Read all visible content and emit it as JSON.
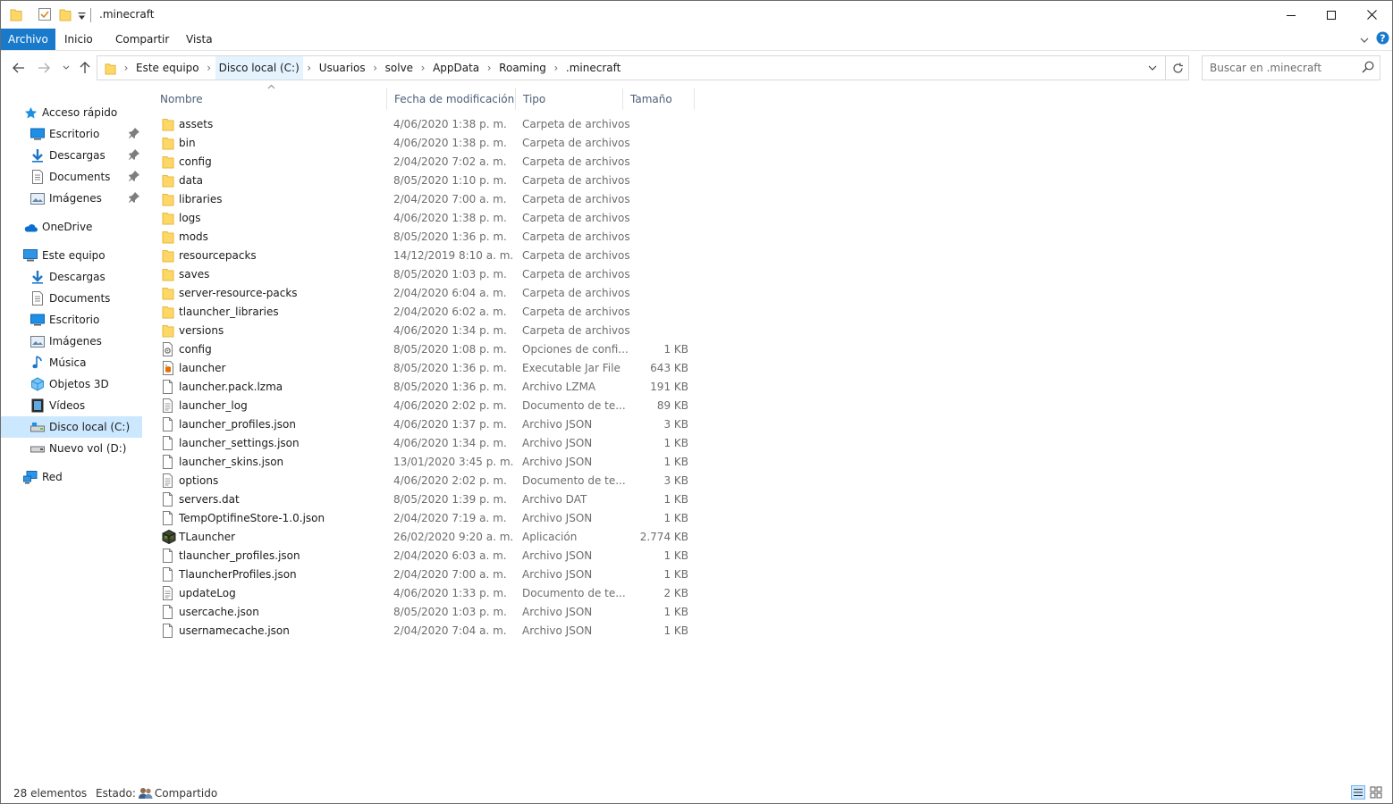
{
  "window": {
    "title": ".minecraft"
  },
  "ribbon": {
    "tabs": [
      "Archivo",
      "Inicio",
      "Compartir",
      "Vista"
    ]
  },
  "address": {
    "crumbs": [
      "Este equipo",
      "Disco local (C:)",
      "Usuarios",
      "solve",
      "AppData",
      "Roaming",
      ".minecraft"
    ],
    "search_placeholder": "Buscar en .minecraft"
  },
  "nav": {
    "items": [
      {
        "label": "Acceso rápido",
        "icon": "star-icon"
      },
      {
        "label": "Escritorio",
        "icon": "desktop-icon",
        "pinned": true
      },
      {
        "label": "Descargas",
        "icon": "download-icon",
        "pinned": true
      },
      {
        "label": "Documents",
        "icon": "document-icon",
        "pinned": true
      },
      {
        "label": "Imágenes",
        "icon": "image-icon",
        "pinned": true
      },
      {
        "label": "OneDrive",
        "icon": "cloud-icon"
      },
      {
        "label": "Este equipo",
        "icon": "computer-icon"
      },
      {
        "label": "Descargas",
        "icon": "download-icon"
      },
      {
        "label": "Documents",
        "icon": "document-icon"
      },
      {
        "label": "Escritorio",
        "icon": "desktop-icon"
      },
      {
        "label": "Imágenes",
        "icon": "image-icon"
      },
      {
        "label": "Música",
        "icon": "music-icon"
      },
      {
        "label": "Objetos 3D",
        "icon": "cube-icon"
      },
      {
        "label": "Vídeos",
        "icon": "video-icon"
      },
      {
        "label": "Disco local (C:)",
        "icon": "drive-icon",
        "selected": true
      },
      {
        "label": "Nuevo vol (D:)",
        "icon": "drive-icon"
      },
      {
        "label": "Red",
        "icon": "network-icon"
      }
    ]
  },
  "columns": {
    "name": "Nombre",
    "date": "Fecha de modificación",
    "type": "Tipo",
    "size": "Tamaño"
  },
  "files": [
    {
      "name": "assets",
      "date": "4/06/2020 1:38 p. m.",
      "type": "Carpeta de archivos",
      "size": "",
      "icon": "folder-icon"
    },
    {
      "name": "bin",
      "date": "4/06/2020 1:38 p. m.",
      "type": "Carpeta de archivos",
      "size": "",
      "icon": "folder-icon"
    },
    {
      "name": "config",
      "date": "2/04/2020 7:02 a. m.",
      "type": "Carpeta de archivos",
      "size": "",
      "icon": "folder-icon"
    },
    {
      "name": "data",
      "date": "8/05/2020 1:10 p. m.",
      "type": "Carpeta de archivos",
      "size": "",
      "icon": "folder-icon"
    },
    {
      "name": "libraries",
      "date": "2/04/2020 7:00 a. m.",
      "type": "Carpeta de archivos",
      "size": "",
      "icon": "folder-icon"
    },
    {
      "name": "logs",
      "date": "4/06/2020 1:38 p. m.",
      "type": "Carpeta de archivos",
      "size": "",
      "icon": "folder-icon"
    },
    {
      "name": "mods",
      "date": "8/05/2020 1:36 p. m.",
      "type": "Carpeta de archivos",
      "size": "",
      "icon": "folder-icon"
    },
    {
      "name": "resourcepacks",
      "date": "14/12/2019 8:10 a. m.",
      "type": "Carpeta de archivos",
      "size": "",
      "icon": "folder-icon"
    },
    {
      "name": "saves",
      "date": "8/05/2020 1:03 p. m.",
      "type": "Carpeta de archivos",
      "size": "",
      "icon": "folder-icon"
    },
    {
      "name": "server-resource-packs",
      "date": "2/04/2020 6:04 a. m.",
      "type": "Carpeta de archivos",
      "size": "",
      "icon": "folder-icon"
    },
    {
      "name": "tlauncher_libraries",
      "date": "2/04/2020 6:02 a. m.",
      "type": "Carpeta de archivos",
      "size": "",
      "icon": "folder-icon"
    },
    {
      "name": "versions",
      "date": "4/06/2020 1:34 p. m.",
      "type": "Carpeta de archivos",
      "size": "",
      "icon": "folder-icon"
    },
    {
      "name": "config",
      "date": "8/05/2020 1:08 p. m.",
      "type": "Opciones de confi...",
      "size": "1 KB",
      "icon": "settings-file-icon"
    },
    {
      "name": "launcher",
      "date": "8/05/2020 1:36 p. m.",
      "type": "Executable Jar File",
      "size": "643 KB",
      "icon": "jar-file-icon"
    },
    {
      "name": "launcher.pack.lzma",
      "date": "8/05/2020 1:36 p. m.",
      "type": "Archivo LZMA",
      "size": "191 KB",
      "icon": "file-icon"
    },
    {
      "name": "launcher_log",
      "date": "4/06/2020 2:02 p. m.",
      "type": "Documento de te...",
      "size": "89 KB",
      "icon": "text-file-icon"
    },
    {
      "name": "launcher_profiles.json",
      "date": "4/06/2020 1:37 p. m.",
      "type": "Archivo JSON",
      "size": "3 KB",
      "icon": "file-icon"
    },
    {
      "name": "launcher_settings.json",
      "date": "4/06/2020 1:34 p. m.",
      "type": "Archivo JSON",
      "size": "1 KB",
      "icon": "file-icon"
    },
    {
      "name": "launcher_skins.json",
      "date": "13/01/2020 3:45 p. m.",
      "type": "Archivo JSON",
      "size": "1 KB",
      "icon": "file-icon"
    },
    {
      "name": "options",
      "date": "4/06/2020 2:02 p. m.",
      "type": "Documento de te...",
      "size": "3 KB",
      "icon": "text-file-icon"
    },
    {
      "name": "servers.dat",
      "date": "8/05/2020 1:39 p. m.",
      "type": "Archivo DAT",
      "size": "1 KB",
      "icon": "file-icon"
    },
    {
      "name": "TempOptifineStore-1.0.json",
      "date": "2/04/2020 7:19 a. m.",
      "type": "Archivo JSON",
      "size": "1 KB",
      "icon": "file-icon"
    },
    {
      "name": "TLauncher",
      "date": "26/02/2020 9:20 a. m.",
      "type": "Aplicación",
      "size": "2.774 KB",
      "icon": "tlauncher-app-icon"
    },
    {
      "name": "tlauncher_profiles.json",
      "date": "2/04/2020 6:03 a. m.",
      "type": "Archivo JSON",
      "size": "1 KB",
      "icon": "file-icon"
    },
    {
      "name": "TlauncherProfiles.json",
      "date": "2/04/2020 7:00 a. m.",
      "type": "Archivo JSON",
      "size": "1 KB",
      "icon": "file-icon"
    },
    {
      "name": "updateLog",
      "date": "4/06/2020 1:33 p. m.",
      "type": "Documento de te...",
      "size": "2 KB",
      "icon": "text-file-icon"
    },
    {
      "name": "usercache.json",
      "date": "8/05/2020 1:03 p. m.",
      "type": "Archivo JSON",
      "size": "1 KB",
      "icon": "file-icon"
    },
    {
      "name": "usernamecache.json",
      "date": "2/04/2020 7:04 a. m.",
      "type": "Archivo JSON",
      "size": "1 KB",
      "icon": "file-icon"
    }
  ],
  "status": {
    "count": "28 elementos",
    "state_label": "Estado:",
    "state_value": "Compartido"
  },
  "colors": {
    "accent": "#1979ca",
    "selection": "#cce8ff",
    "folder": "#ffd766",
    "header_text": "#4c607a"
  }
}
